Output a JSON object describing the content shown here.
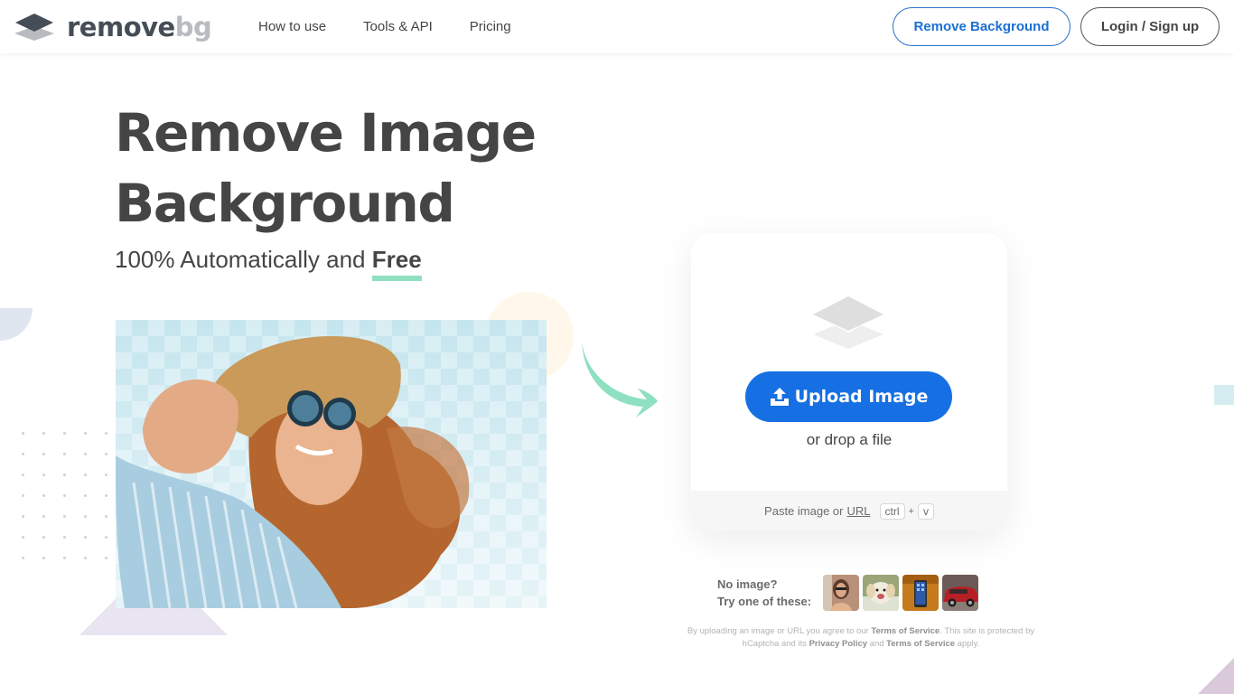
{
  "header": {
    "logo": {
      "word1": "remove",
      "word2": "bg",
      "icon": "layers-icon"
    },
    "nav": [
      {
        "label": "How to use"
      },
      {
        "label": "Tools & API"
      },
      {
        "label": "Pricing"
      }
    ],
    "remove_background_label": "Remove Background",
    "login_label": "Login / Sign up"
  },
  "hero": {
    "title_line1": "Remove Image",
    "title_line2": "Background",
    "subtitle_prefix": "100% Automatically and ",
    "subtitle_highlight": "Free",
    "accent_color": "#8ee0c0"
  },
  "upload": {
    "button_label": "Upload Image",
    "button_icon": "upload-icon",
    "drop_text": "or drop a file",
    "paste_prefix": "Paste image or",
    "paste_link": "URL",
    "key1": "ctrl",
    "key_plus": "+",
    "key2": "v",
    "button_color": "#1770e3"
  },
  "samples": {
    "label_line1": "No image?",
    "label_line2": "Try one of these:",
    "items": [
      {
        "alt": "woman-sample"
      },
      {
        "alt": "dog-sample"
      },
      {
        "alt": "phone-sample"
      },
      {
        "alt": "car-sample"
      }
    ]
  },
  "legal": {
    "t1": "By uploading an image or URL you agree to our ",
    "terms1": "Terms of Service",
    "t2": ". This site is protected by hCaptcha and its ",
    "privacy": "Privacy Policy",
    "t3": " and ",
    "terms2": "Terms of Service",
    "t4": " apply."
  }
}
